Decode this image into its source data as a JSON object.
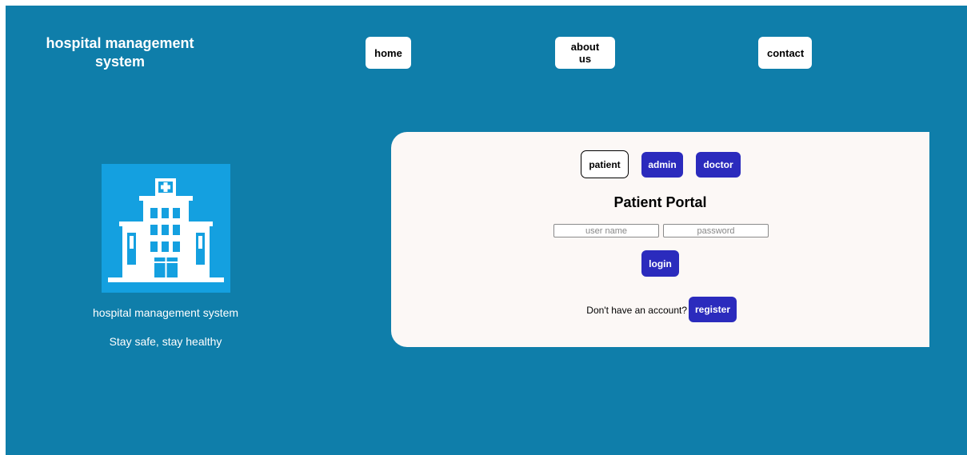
{
  "header": {
    "brand": "hospital management system",
    "nav": {
      "home": "home",
      "about": "about us",
      "contact": "contact"
    }
  },
  "hero": {
    "icon": "hospital-building-icon",
    "title": "hospital management system",
    "tagline": "Stay safe, stay healthy"
  },
  "portal": {
    "roles": {
      "patient": "patient",
      "admin": "admin",
      "doctor": "doctor"
    },
    "active_role": "patient",
    "title": "Patient Portal",
    "username_placeholder": "user name",
    "password_placeholder": "password",
    "login_label": "login",
    "register_prompt": "Don't have an account?",
    "register_label": "register"
  },
  "colors": {
    "background": "#0f7eaa",
    "card": "#fcf8f6",
    "accent": "#2b2bbd",
    "hero_bg": "#14a0e0"
  }
}
